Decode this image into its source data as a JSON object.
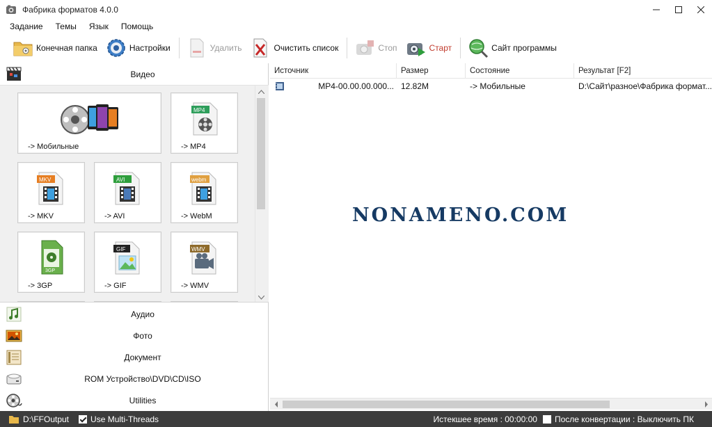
{
  "window": {
    "title": "Фабрика форматов 4.0.0"
  },
  "menu": [
    "Задание",
    "Темы",
    "Язык",
    "Помощь"
  ],
  "toolbar": {
    "output_folder": "Конечная папка",
    "settings": "Настройки",
    "delete": "Удалить",
    "clear_list": "Очистить список",
    "stop": "Стоп",
    "start": "Старт",
    "website": "Сайт программы"
  },
  "left_panel": {
    "video_category": "Видео",
    "tiles": [
      {
        "label": "-> Мобильные",
        "icon": "mobile-devices-icon"
      },
      {
        "label": "-> MP4",
        "icon": "mp4-file-icon",
        "badge": "MP4"
      },
      {
        "label": "-> MKV",
        "icon": "mkv-file-icon",
        "badge": "MKV"
      },
      {
        "label": "-> AVI",
        "icon": "avi-file-icon",
        "badge": "AVI"
      },
      {
        "label": "-> WebM",
        "icon": "webm-file-icon",
        "badge": "webm"
      },
      {
        "label": "-> 3GP",
        "icon": "3gp-file-icon",
        "badge": "3GP"
      },
      {
        "label": "-> GIF",
        "icon": "gif-file-icon",
        "badge": "GIF"
      },
      {
        "label": "-> WMV",
        "icon": "wmv-file-icon",
        "badge": "WMV"
      }
    ],
    "categories": [
      {
        "label": "Аудио",
        "icon": "audio-note-icon"
      },
      {
        "label": "Фото",
        "icon": "photo-icon"
      },
      {
        "label": "Документ",
        "icon": "document-icon"
      },
      {
        "label": "ROM Устройство\\DVD\\CD\\ISO",
        "icon": "disc-drive-icon"
      },
      {
        "label": "Utilities",
        "icon": "utilities-reel-icon"
      }
    ]
  },
  "task_list": {
    "columns": [
      "Источник",
      "Размер",
      "Состояние",
      "Результат [F2]"
    ],
    "rows": [
      {
        "source": "MP4-00.00.00.000...",
        "size": "12.82M",
        "status": "-> Мобильные",
        "result": "D:\\Сайт\\разное\\Фабрика формат..."
      }
    ]
  },
  "watermark": "NONAMENO.COM",
  "status_bar": {
    "output_path": "D:\\FFOutput",
    "multithread_label": "Use Multi-Threads",
    "multithread_checked": true,
    "elapsed": "Истекшее время : 00:00:00",
    "after_convert": "После конвертации : Выключить ПК",
    "after_convert_checked": false
  },
  "colors": {
    "statusbar_bg": "#3c3c3c",
    "start_label": "#c0392b",
    "watermark": "#163a63"
  }
}
